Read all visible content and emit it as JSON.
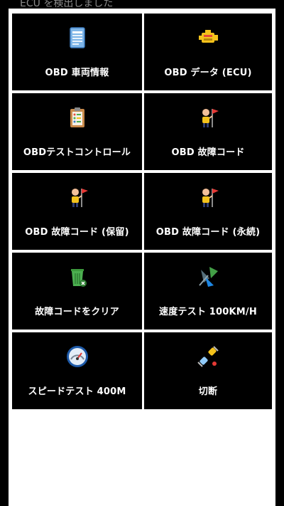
{
  "status": {
    "text": "ECU を検出しました"
  },
  "menu": {
    "items": [
      {
        "label": "OBD 車両情報",
        "icon": "document-icon"
      },
      {
        "label": "OBD データ (ECU)",
        "icon": "engine-icon"
      },
      {
        "label": "OBDテストコントロール",
        "icon": "clipboard-icon"
      },
      {
        "label": "OBD 故障コード",
        "icon": "person-flag-icon"
      },
      {
        "label": "OBD 故障コード (保留)",
        "icon": "person-flag-icon"
      },
      {
        "label": "OBD 故障コード (永続)",
        "icon": "person-flag-icon"
      },
      {
        "label": "故障コードをクリア",
        "icon": "trash-icon"
      },
      {
        "label": "速度テスト 100KM/H",
        "icon": "speed-flag-icon"
      },
      {
        "label": "スピードテスト 400M",
        "icon": "speedometer-icon"
      },
      {
        "label": "切断",
        "icon": "disconnect-plug-icon"
      }
    ]
  }
}
